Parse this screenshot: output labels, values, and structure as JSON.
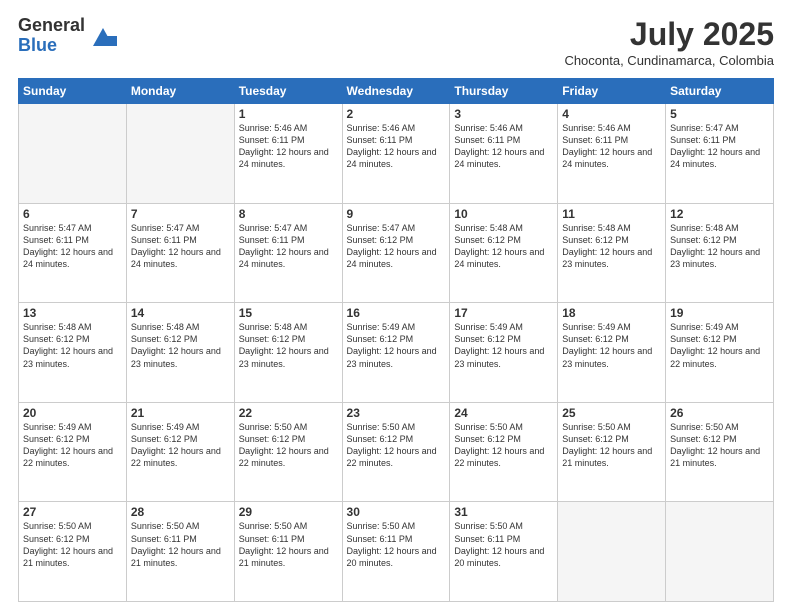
{
  "logo": {
    "general": "General",
    "blue": "Blue"
  },
  "title": {
    "month_year": "July 2025",
    "location": "Choconta, Cundinamarca, Colombia"
  },
  "weekdays": [
    "Sunday",
    "Monday",
    "Tuesday",
    "Wednesday",
    "Thursday",
    "Friday",
    "Saturday"
  ],
  "weeks": [
    [
      {
        "day": "",
        "info": ""
      },
      {
        "day": "",
        "info": ""
      },
      {
        "day": "1",
        "info": "Sunrise: 5:46 AM\nSunset: 6:11 PM\nDaylight: 12 hours and 24 minutes."
      },
      {
        "day": "2",
        "info": "Sunrise: 5:46 AM\nSunset: 6:11 PM\nDaylight: 12 hours and 24 minutes."
      },
      {
        "day": "3",
        "info": "Sunrise: 5:46 AM\nSunset: 6:11 PM\nDaylight: 12 hours and 24 minutes."
      },
      {
        "day": "4",
        "info": "Sunrise: 5:46 AM\nSunset: 6:11 PM\nDaylight: 12 hours and 24 minutes."
      },
      {
        "day": "5",
        "info": "Sunrise: 5:47 AM\nSunset: 6:11 PM\nDaylight: 12 hours and 24 minutes."
      }
    ],
    [
      {
        "day": "6",
        "info": "Sunrise: 5:47 AM\nSunset: 6:11 PM\nDaylight: 12 hours and 24 minutes."
      },
      {
        "day": "7",
        "info": "Sunrise: 5:47 AM\nSunset: 6:11 PM\nDaylight: 12 hours and 24 minutes."
      },
      {
        "day": "8",
        "info": "Sunrise: 5:47 AM\nSunset: 6:11 PM\nDaylight: 12 hours and 24 minutes."
      },
      {
        "day": "9",
        "info": "Sunrise: 5:47 AM\nSunset: 6:12 PM\nDaylight: 12 hours and 24 minutes."
      },
      {
        "day": "10",
        "info": "Sunrise: 5:48 AM\nSunset: 6:12 PM\nDaylight: 12 hours and 24 minutes."
      },
      {
        "day": "11",
        "info": "Sunrise: 5:48 AM\nSunset: 6:12 PM\nDaylight: 12 hours and 23 minutes."
      },
      {
        "day": "12",
        "info": "Sunrise: 5:48 AM\nSunset: 6:12 PM\nDaylight: 12 hours and 23 minutes."
      }
    ],
    [
      {
        "day": "13",
        "info": "Sunrise: 5:48 AM\nSunset: 6:12 PM\nDaylight: 12 hours and 23 minutes."
      },
      {
        "day": "14",
        "info": "Sunrise: 5:48 AM\nSunset: 6:12 PM\nDaylight: 12 hours and 23 minutes."
      },
      {
        "day": "15",
        "info": "Sunrise: 5:48 AM\nSunset: 6:12 PM\nDaylight: 12 hours and 23 minutes."
      },
      {
        "day": "16",
        "info": "Sunrise: 5:49 AM\nSunset: 6:12 PM\nDaylight: 12 hours and 23 minutes."
      },
      {
        "day": "17",
        "info": "Sunrise: 5:49 AM\nSunset: 6:12 PM\nDaylight: 12 hours and 23 minutes."
      },
      {
        "day": "18",
        "info": "Sunrise: 5:49 AM\nSunset: 6:12 PM\nDaylight: 12 hours and 23 minutes."
      },
      {
        "day": "19",
        "info": "Sunrise: 5:49 AM\nSunset: 6:12 PM\nDaylight: 12 hours and 22 minutes."
      }
    ],
    [
      {
        "day": "20",
        "info": "Sunrise: 5:49 AM\nSunset: 6:12 PM\nDaylight: 12 hours and 22 minutes."
      },
      {
        "day": "21",
        "info": "Sunrise: 5:49 AM\nSunset: 6:12 PM\nDaylight: 12 hours and 22 minutes."
      },
      {
        "day": "22",
        "info": "Sunrise: 5:50 AM\nSunset: 6:12 PM\nDaylight: 12 hours and 22 minutes."
      },
      {
        "day": "23",
        "info": "Sunrise: 5:50 AM\nSunset: 6:12 PM\nDaylight: 12 hours and 22 minutes."
      },
      {
        "day": "24",
        "info": "Sunrise: 5:50 AM\nSunset: 6:12 PM\nDaylight: 12 hours and 22 minutes."
      },
      {
        "day": "25",
        "info": "Sunrise: 5:50 AM\nSunset: 6:12 PM\nDaylight: 12 hours and 21 minutes."
      },
      {
        "day": "26",
        "info": "Sunrise: 5:50 AM\nSunset: 6:12 PM\nDaylight: 12 hours and 21 minutes."
      }
    ],
    [
      {
        "day": "27",
        "info": "Sunrise: 5:50 AM\nSunset: 6:12 PM\nDaylight: 12 hours and 21 minutes."
      },
      {
        "day": "28",
        "info": "Sunrise: 5:50 AM\nSunset: 6:11 PM\nDaylight: 12 hours and 21 minutes."
      },
      {
        "day": "29",
        "info": "Sunrise: 5:50 AM\nSunset: 6:11 PM\nDaylight: 12 hours and 21 minutes."
      },
      {
        "day": "30",
        "info": "Sunrise: 5:50 AM\nSunset: 6:11 PM\nDaylight: 12 hours and 20 minutes."
      },
      {
        "day": "31",
        "info": "Sunrise: 5:50 AM\nSunset: 6:11 PM\nDaylight: 12 hours and 20 minutes."
      },
      {
        "day": "",
        "info": ""
      },
      {
        "day": "",
        "info": ""
      }
    ]
  ]
}
